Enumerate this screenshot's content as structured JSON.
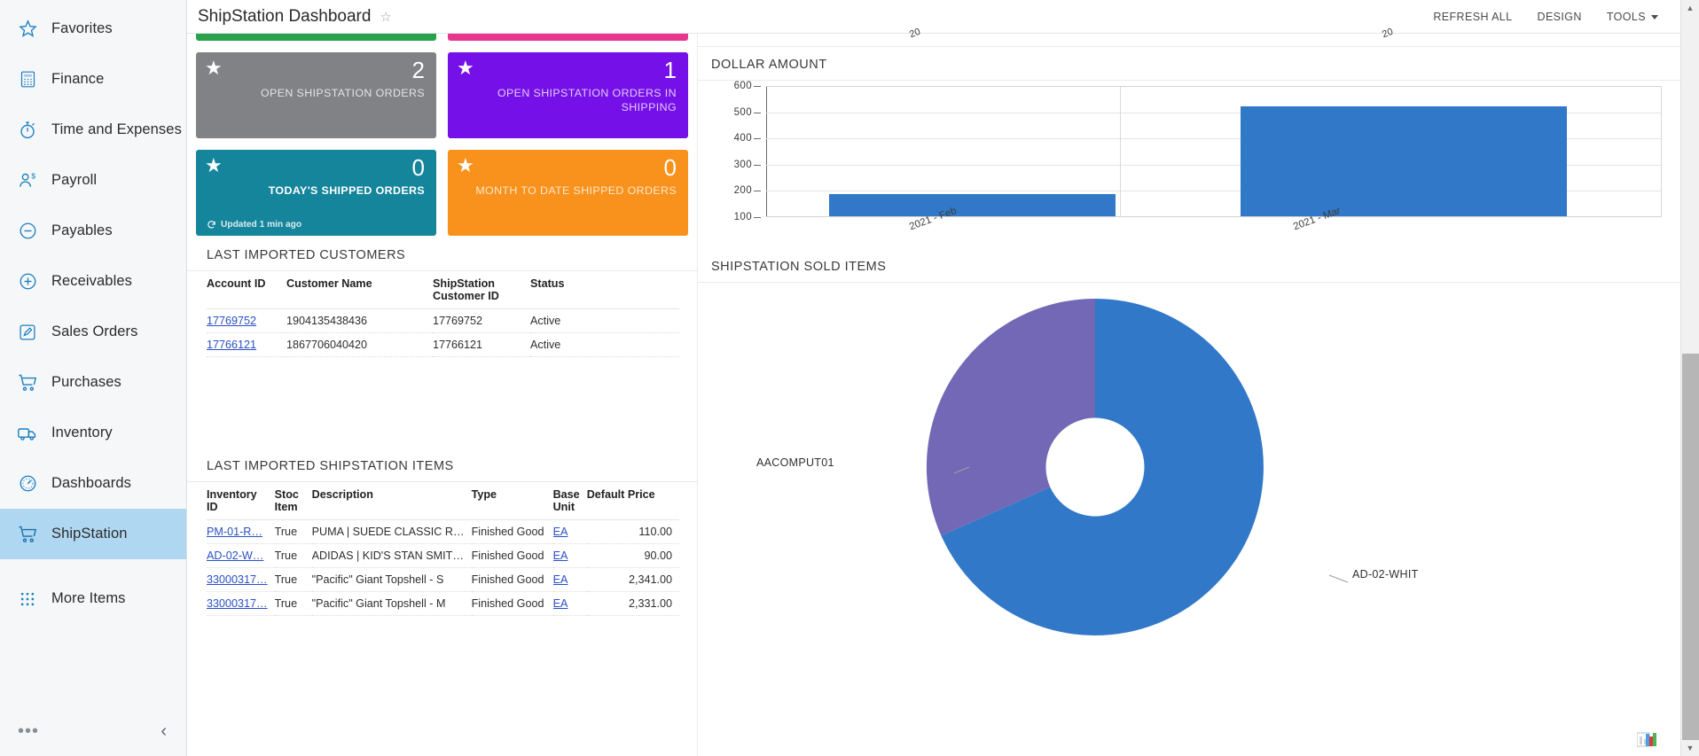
{
  "sidebar": {
    "items": [
      {
        "label": "Favorites",
        "icon": "star-outline-icon",
        "active": false
      },
      {
        "label": "Finance",
        "icon": "calculator-icon",
        "active": false
      },
      {
        "label": "Time and Expenses",
        "icon": "stopwatch-icon",
        "active": false
      },
      {
        "label": "Payroll",
        "icon": "person-dollar-icon",
        "active": false
      },
      {
        "label": "Payables",
        "icon": "minus-circle-icon",
        "active": false
      },
      {
        "label": "Receivables",
        "icon": "plus-circle-icon",
        "active": false
      },
      {
        "label": "Sales Orders",
        "icon": "pencil-square-icon",
        "active": false
      },
      {
        "label": "Purchases",
        "icon": "shopping-cart-icon",
        "active": false
      },
      {
        "label": "Inventory",
        "icon": "truck-icon",
        "active": false
      },
      {
        "label": "Dashboards",
        "icon": "gauge-icon",
        "active": false
      },
      {
        "label": "ShipStation",
        "icon": "shopping-cart-icon",
        "active": true
      },
      {
        "label": "More Items",
        "icon": "grid-dots-icon",
        "active": false
      }
    ],
    "footer": {
      "more_icon": "ellipsis-icon",
      "collapse_icon": "chevron-left-icon"
    }
  },
  "header": {
    "title": "ShipStation Dashboard",
    "favorite_icon": "star-outline-icon",
    "actions": [
      {
        "label": "REFRESH ALL",
        "name": "refresh-all-button"
      },
      {
        "label": "DESIGN",
        "name": "design-button"
      },
      {
        "label": "TOOLS",
        "name": "tools-menu"
      }
    ]
  },
  "tiles": {
    "cutoff_colors": [
      "#2aa24b",
      "#e8368f"
    ],
    "items": [
      {
        "value": "2",
        "caption": "OPEN SHIPSTATION ORDERS",
        "color": "#808285",
        "bright": false
      },
      {
        "value": "1",
        "caption": "OPEN SHIPSTATION ORDERS IN SHIPPING",
        "color": "#7610e8",
        "bright": false
      },
      {
        "value": "0",
        "caption": "TODAY'S SHIPPED ORDERS",
        "color": "#15859b",
        "bright": true,
        "updated": "Updated 1 min ago",
        "updated_icon": "refresh-icon"
      },
      {
        "value": "0",
        "caption": "MONTH TO DATE SHIPPED ORDERS",
        "color": "#f8921d",
        "bright": false
      }
    ]
  },
  "customers_panel": {
    "title": "LAST IMPORTED CUSTOMERS",
    "columns": [
      "Account ID",
      "Customer Name",
      "ShipStation Customer ID",
      "Status"
    ],
    "rows": [
      {
        "account_id": "17769752",
        "customer_name": "1904135438436",
        "shipstation_customer_id": "17769752",
        "status": "Active"
      },
      {
        "account_id": "17766121",
        "customer_name": "1867706040420",
        "shipstation_customer_id": "17766121",
        "status": "Active"
      }
    ]
  },
  "items_panel": {
    "title": "LAST IMPORTED SHIPSTATION ITEMS",
    "columns": [
      "Inventory ID",
      "Stoc Item",
      "Description",
      "Type",
      "Base Unit",
      "Default Price"
    ],
    "rows": [
      {
        "inventory_id": "PM-01-R…",
        "stock_item": "True",
        "description": "PUMA | SUEDE CLASSIC R…",
        "type": "Finished Good",
        "base_unit": "EA",
        "default_price": "110.00"
      },
      {
        "inventory_id": "AD-02-W…",
        "stock_item": "True",
        "description": "ADIDAS | KID'S STAN SMIT…",
        "type": "Finished Good",
        "base_unit": "EA",
        "default_price": "90.00"
      },
      {
        "inventory_id": "33000317…",
        "stock_item": "True",
        "description": "\"Pacific\" Giant Topshell - S",
        "type": "Finished Good",
        "base_unit": "EA",
        "default_price": "2,341.00"
      },
      {
        "inventory_id": "33000317…",
        "stock_item": "True",
        "description": "\"Pacific\" Giant Topshell - M",
        "type": "Finished Good",
        "base_unit": "EA",
        "default_price": "2,331.00"
      }
    ]
  },
  "dollar_panel": {
    "title": "DOLLAR AMOUNT"
  },
  "sold_panel": {
    "title": "SHIPSTATION SOLD ITEMS"
  },
  "chart_data": [
    {
      "type": "bar",
      "title": "DOLLAR AMOUNT",
      "categories": [
        "2021 - Feb",
        "2021 - Mar"
      ],
      "values": [
        185,
        525
      ],
      "xlabel": "",
      "ylabel": "",
      "ylim": [
        100,
        600
      ],
      "yticks": [
        100,
        200,
        300,
        400,
        500,
        600
      ],
      "grid": true,
      "legend": "none",
      "series_color": "#3179c8"
    },
    {
      "type": "pie",
      "variant": "donut",
      "title": "SHIPSTATION SOLD ITEMS",
      "labels": [
        "AD-02-WHIT",
        "AACOMPUT01"
      ],
      "values": [
        66.7,
        33.3
      ],
      "colors": [
        "#3179c8",
        "#7268b5"
      ],
      "legend": "labels-outside",
      "annotations": [
        "AACOMPUT01",
        "AD-02-WHIT"
      ]
    }
  ],
  "cut_labels": {
    "left": "20",
    "right": "20"
  },
  "scrollbar": {
    "up_icon": "chevron-up-icon",
    "down_icon": "chevron-down-icon"
  },
  "chart_badge_icon": "chart-type-icon"
}
